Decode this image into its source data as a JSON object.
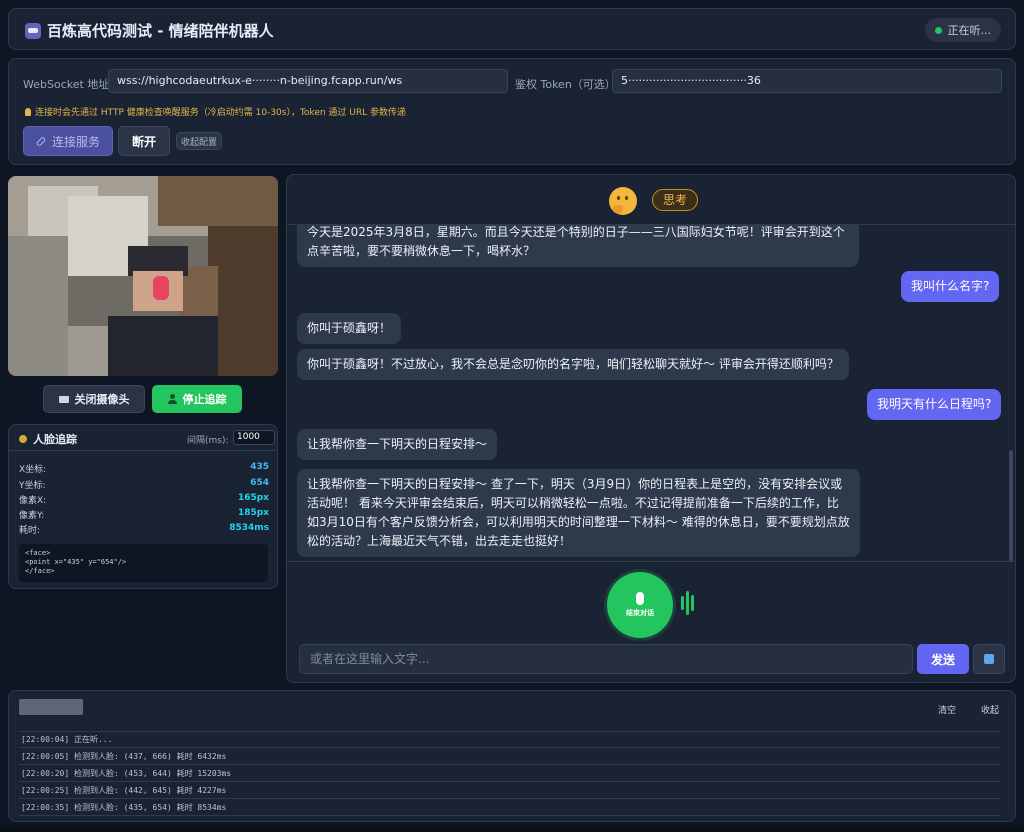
{
  "header": {
    "title": "百炼高代码测试 - 情绪陪伴机器人",
    "status": "正在听..."
  },
  "config": {
    "ws_label": "WebSocket 地址:",
    "ws_value": "wss://highcodaeutrkux-e········n-beijing.fcapp.run/ws",
    "token_label": "鉴权 Token（可选）:",
    "token_value": "5··································36",
    "hint": "连接时会先通过 HTTP 健康检查唤醒服务（冷启动约需 10-30s），Token 通过 URL 参数传递",
    "connect_label": "连接服务",
    "disconnect_label": "断开",
    "collapse_label": "收起配置"
  },
  "camera": {
    "close_label": "关闭摄像头",
    "stop_label": "停止追踪"
  },
  "face": {
    "title": "人脸追踪",
    "interval_label": "间隔(ms):",
    "interval_value": "1000",
    "rows": [
      {
        "label": "X坐标:",
        "value": "435"
      },
      {
        "label": "Y坐标:",
        "value": "654"
      },
      {
        "label": "像素X:",
        "value": "165px"
      },
      {
        "label": "像素Y:",
        "value": "185px"
      },
      {
        "label": "耗时:",
        "value": "8534ms"
      }
    ],
    "code": "<face>\n<point x=\"435\" y=\"654\"/>\n</face>"
  },
  "chat": {
    "status_badge": "思考",
    "messages": [
      {
        "role": "bot",
        "text": "今天是2025年3月8日，星期六。而且今天还是个特别的日子——三八国际妇女节呢！评审会开到这个点辛苦啦，要不要稍微休息一下，喝杯水？"
      },
      {
        "role": "user",
        "text": "我叫什么名字?"
      },
      {
        "role": "bot",
        "text": "你叫于硕鑫呀！"
      },
      {
        "role": "bot",
        "text": "你叫于硕鑫呀！不过放心，我不会总是念叨你的名字啦，咱们轻松聊天就好～ 评审会开得还顺利吗？"
      },
      {
        "role": "user",
        "text": "我明天有什么日程吗?"
      },
      {
        "role": "bot",
        "text": "让我帮你查一下明天的日程安排～"
      },
      {
        "role": "bot",
        "text": "让我帮你查一下明天的日程安排～ 查了一下，明天（3月9日）你的日程表上是空的，没有安排会议或活动呢！ 看来今天评审会结束后，明天可以稍微轻松一点啦。不过记得提前准备一下后续的工作，比如3月10日有个客户反馈分析会，可以利用明天的时间整理一下材料～ 难得的休息日，要不要规划点放松的活动？上海最近天气不错，出去走走也挺好！"
      }
    ],
    "end_talk_label": "结束对话",
    "input_placeholder": "或者在这里输入文字...",
    "send_label": "发送"
  },
  "log": {
    "clear_label": "清空",
    "collapse_label": "收起",
    "lines": [
      "[22:00:04] 正在听...",
      "[22:00:05] 检测到人脸: (437, 666) 耗时 6432ms",
      "[22:00:20] 检测到人脸: (453, 644) 耗时 15203ms",
      "[22:00:25] 检测到人脸: (442, 645) 耗时 4227ms",
      "[22:00:35] 检测到人脸: (435, 654) 耗时 8534ms"
    ]
  }
}
